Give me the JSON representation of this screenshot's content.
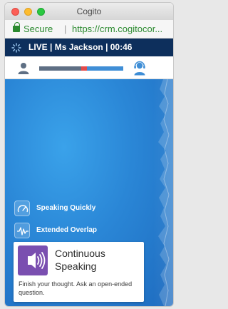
{
  "window": {
    "title": "Cogito"
  },
  "addressbar": {
    "secure_label": "Secure",
    "separator": "|",
    "url": "https://crm.cogitocor..."
  },
  "call": {
    "status_text": "LIVE | Ms Jackson | 00:46"
  },
  "talk_balance": {
    "customer_share": 0.5,
    "overlap_share": 0.07,
    "agent_share": 0.43,
    "colors": {
      "customer": "#5e6f84",
      "overlap": "#e34a4a",
      "agent": "#3f8ed6"
    }
  },
  "cues": [
    {
      "label": "Speaking Quickly",
      "icon": "speedometer-icon"
    },
    {
      "label": "Extended Overlap",
      "icon": "overlap-wave-icon"
    }
  ],
  "notification": {
    "title": "Continuous Speaking",
    "body": "Finish your thought. Ask an open-ended question.",
    "icon": "speaking-icon",
    "accent": "#7a4fb0"
  },
  "colors": {
    "header": "#0d2f5c",
    "stage": "#2a86d6",
    "secure": "#2b8a2f"
  }
}
